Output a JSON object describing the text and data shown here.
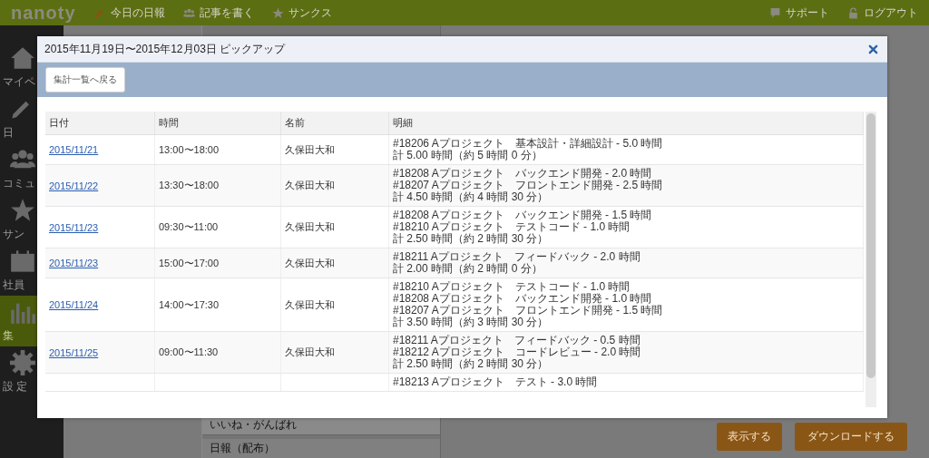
{
  "topbar": {
    "logo": "nanoty",
    "nav": [
      {
        "label": "今日の日報"
      },
      {
        "label": "記事を書く"
      },
      {
        "label": "サンクス"
      }
    ],
    "links": [
      {
        "label": "サポート"
      },
      {
        "label": "ログアウト"
      }
    ]
  },
  "sidebar": {
    "items": [
      {
        "label": "マイペ",
        "selected": false
      },
      {
        "label": "日",
        "selected": false
      },
      {
        "label": "コミュ",
        "selected": false
      },
      {
        "label": "サン",
        "selected": false
      },
      {
        "label": "社員",
        "selected": false
      },
      {
        "label": "集",
        "selected": true
      },
      {
        "label": "設 定",
        "selected": false
      }
    ]
  },
  "background": {
    "list_items": [
      "いいね・がんばれ",
      "日報（配布）"
    ],
    "buttons": [
      "表示する",
      "ダウンロードする"
    ]
  },
  "modal": {
    "title": "2015年11月19日〜2015年12月03日 ピックアップ",
    "back_button": "集計一覧へ戻る",
    "table": {
      "columns": [
        "日付",
        "時間",
        "名前",
        "明細"
      ],
      "rows": [
        {
          "date": "2015/11/21",
          "time": "13:00〜18:00",
          "name": "久保田大和",
          "details": [
            "#18206 Aプロジェクト　基本設計・詳細設計 - 5.0 時間",
            "計 5.00 時間（約 5 時間 0 分）"
          ]
        },
        {
          "date": "2015/11/22",
          "time": "13:30〜18:00",
          "name": "久保田大和",
          "details": [
            "#18208 Aプロジェクト　バックエンド開発 - 2.0 時間",
            "#18207 Aプロジェクト　フロントエンド開発 - 2.5 時間",
            "計 4.50 時間（約 4 時間 30 分）"
          ]
        },
        {
          "date": "2015/11/23",
          "time": "09:30〜11:00",
          "name": "久保田大和",
          "details": [
            "#18208 Aプロジェクト　バックエンド開発 - 1.5 時間",
            "#18210 Aプロジェクト　テストコード - 1.0 時間",
            "計 2.50 時間（約 2 時間 30 分）"
          ]
        },
        {
          "date": "2015/11/23",
          "time": "15:00〜17:00",
          "name": "久保田大和",
          "details": [
            "#18211 Aプロジェクト　フィードバック - 2.0 時間",
            "計 2.00 時間（約 2 時間 0 分）"
          ]
        },
        {
          "date": "2015/11/24",
          "time": "14:00〜17:30",
          "name": "久保田大和",
          "details": [
            "#18210 Aプロジェクト　テストコード - 1.0 時間",
            "#18208 Aプロジェクト　バックエンド開発 - 1.0 時間",
            "#18207 Aプロジェクト　フロントエンド開発 - 1.5 時間",
            "計 3.50 時間（約 3 時間 30 分）"
          ]
        },
        {
          "date": "2015/11/25",
          "time": "09:00〜11:30",
          "name": "久保田大和",
          "details": [
            "#18211 Aプロジェクト　フィードバック - 0.5 時間",
            "#18212 Aプロジェクト　コードレビュー - 2.0 時間",
            "計 2.50 時間（約 2 時間 30 分）"
          ]
        },
        {
          "details": [
            "#18213 Aプロジェクト　テスト - 3.0 時間"
          ]
        }
      ]
    }
  }
}
